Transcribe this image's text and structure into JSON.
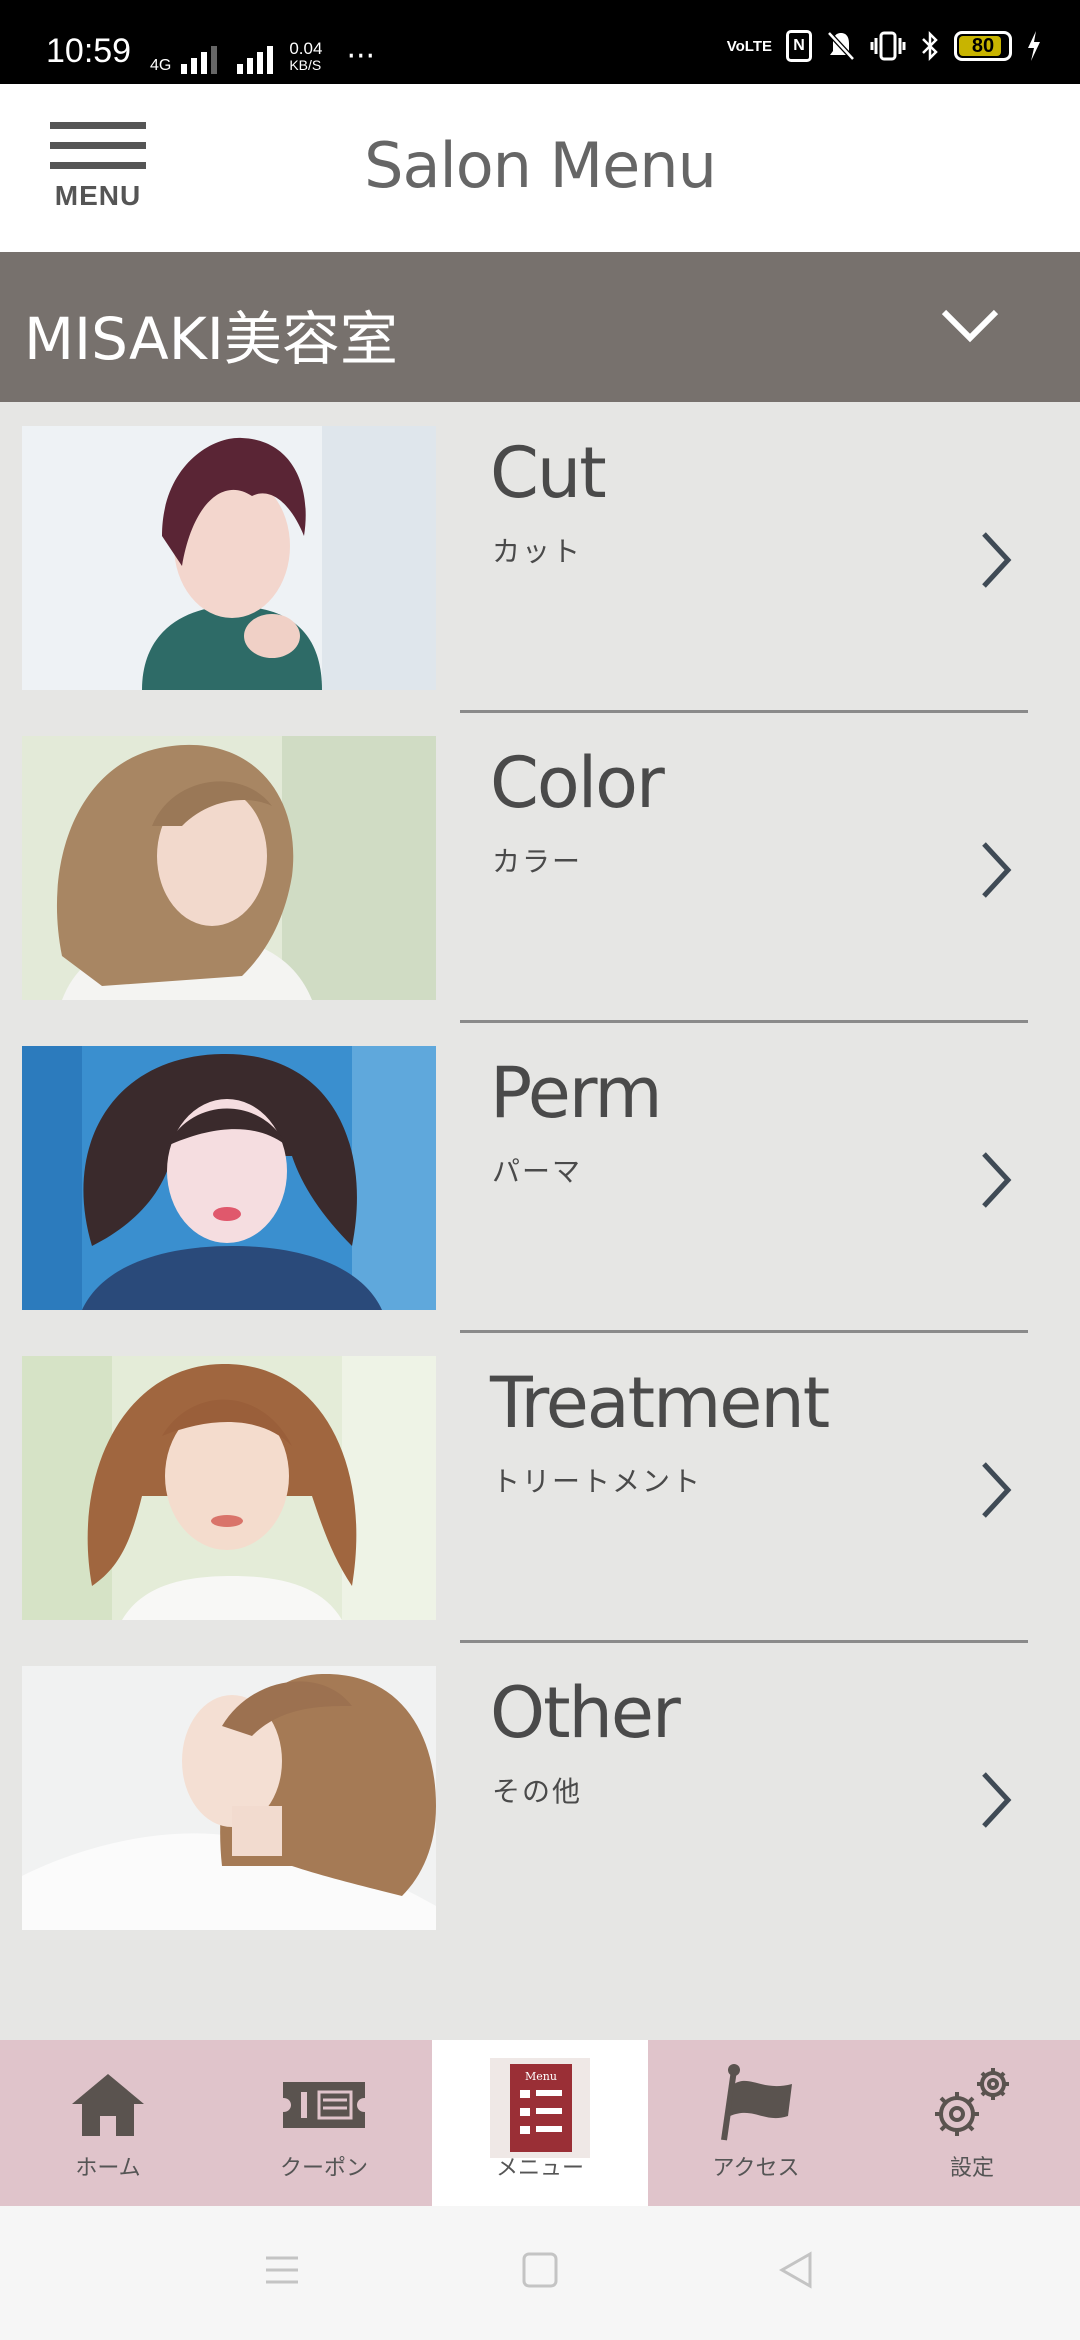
{
  "status_bar": {
    "time": "10:59",
    "network": "4G",
    "speed_value": "0.04",
    "speed_unit": "KB/S",
    "more": "···",
    "volte": "VoLTE",
    "battery": "80"
  },
  "header": {
    "menu_label": "MENU",
    "title": "Salon Menu"
  },
  "salon": {
    "name": "MISAKI美容室"
  },
  "menu_items": [
    {
      "title": "Cut",
      "subtitle": "カット"
    },
    {
      "title": "Color",
      "subtitle": "カラー"
    },
    {
      "title": "Perm",
      "subtitle": "パーマ"
    },
    {
      "title": "Treatment",
      "subtitle": "トリートメント"
    },
    {
      "title": "Other",
      "subtitle": "その他"
    }
  ],
  "tabs": [
    {
      "label": "ホーム",
      "icon": "home-icon"
    },
    {
      "label": "クーポン",
      "icon": "coupon-icon"
    },
    {
      "label": "メニュー",
      "icon": "menu-book-icon",
      "badge": "Menu",
      "active": true
    },
    {
      "label": "アクセス",
      "icon": "flag-icon"
    },
    {
      "label": "設定",
      "icon": "settings-icon"
    }
  ],
  "colors": {
    "salon_bar": "#77716d",
    "tab_bar": "#e0c4cb",
    "active_tab": "#ffffff",
    "menu_icon_accent": "#9a2f36"
  }
}
